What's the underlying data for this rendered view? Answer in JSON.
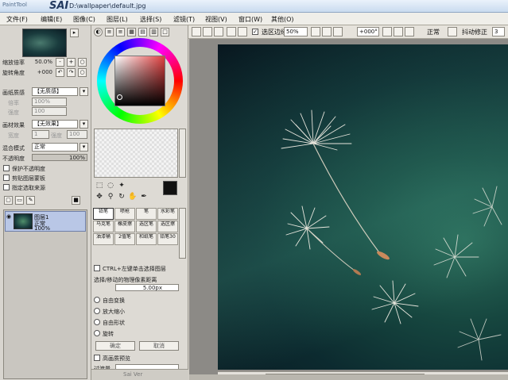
{
  "title_bar": {
    "logo_small": "PaintTool",
    "logo_sai": "SAI",
    "file_path": "D:\\wallpaper\\default.jpg"
  },
  "menu": {
    "items": [
      "文件(F)",
      "编辑(E)",
      "图像(C)",
      "图层(L)",
      "选择(S)",
      "滤镜(T)",
      "视图(V)",
      "窗口(W)",
      "其他(O)"
    ]
  },
  "toolbar": {
    "selection_edge_label": "选区边缘",
    "zoom_value": "50%",
    "angle_value": "+000°",
    "blend_mode": "正常",
    "stabilizer_label": "抖动修正",
    "stabilizer_value": "3"
  },
  "navigator": {
    "zoom_label": "缩放倍率",
    "zoom_value": "50.0%",
    "angle_label": "旋转角度",
    "angle_value": "+000"
  },
  "paper_texture": {
    "label": "画纸质感",
    "value": "【无质感】",
    "scale_label": "倍率",
    "scale_value": "100%",
    "strength_label": "强度",
    "strength_value": "100"
  },
  "paper_effect": {
    "label": "画材效果",
    "value": "【无效果】",
    "width_label": "宽度",
    "width_value": "1",
    "strength_label": "强度",
    "strength_value": "100"
  },
  "layer_props": {
    "blend_label": "混合模式",
    "blend_value": "正常",
    "opacity_label": "不透明度",
    "opacity_value": "100%",
    "opacity_fraction": 1.0,
    "checks": [
      "保护不透明度",
      "剪贴图层蒙板",
      "指定选取来源"
    ]
  },
  "layers": {
    "items": [
      {
        "name": "图层1",
        "mode": "正常",
        "opacity": "100%"
      }
    ]
  },
  "brushes": {
    "cells": [
      "铅笔",
      "喷枪",
      "笔",
      "水彩笔",
      "马克笔",
      "橡皮擦",
      "选区笔",
      "选区擦",
      "油漆桶",
      "2值笔",
      "和纸笔",
      "铅笔30"
    ],
    "selected_index": 0
  },
  "tool_options": {
    "ctrl_check_label": "CTRL+左键单击选择图层",
    "move_label": "选择/移动的物理像素距离",
    "move_value": "5.00px",
    "radios": [
      "自由变换",
      "放大缩小",
      "自由形状",
      "旋转"
    ],
    "ok_button": "确定",
    "cancel_button": "取消",
    "hq_preview_label": "高画质预览",
    "level_label": "过渡量"
  },
  "status": {
    "bottom_button": "Sai Ver"
  }
}
